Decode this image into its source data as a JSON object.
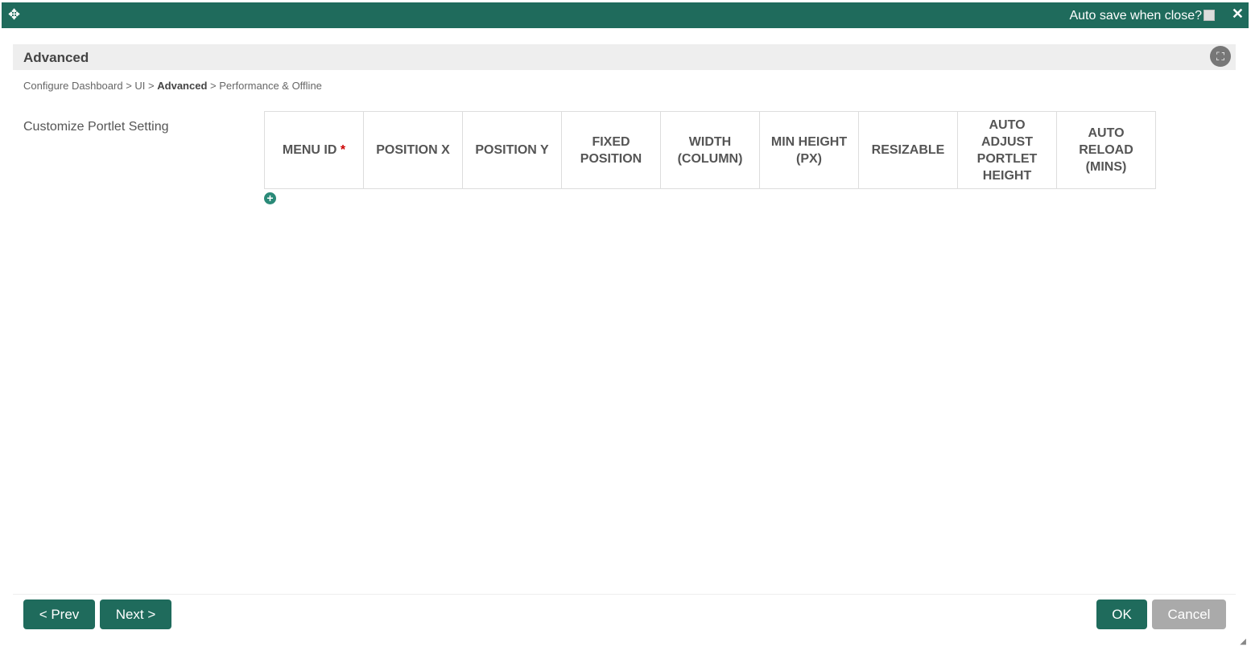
{
  "topbar": {
    "auto_save_label": "Auto save when close?",
    "auto_save_checked": false,
    "close": "✕"
  },
  "panel": {
    "title": "Advanced"
  },
  "breadcrumb": {
    "items": [
      "Configure Dashboard",
      "UI",
      "Advanced",
      "Performance & Offline"
    ],
    "sep": ">"
  },
  "section": {
    "label": "Customize Portlet Setting"
  },
  "table": {
    "headers": [
      "MENU ID",
      "POSITION X",
      "POSITION Y",
      "FIXED POSITION",
      "WIDTH (COLUMN)",
      "MIN HEIGHT (PX)",
      "RESIZABLE",
      "AUTO ADJUST PORTLET HEIGHT",
      "AUTO RELOAD (MINS)"
    ],
    "required_mark": "*"
  },
  "footer": {
    "prev": "< Prev",
    "next": "Next >",
    "ok": "OK",
    "cancel": "Cancel"
  },
  "colors": {
    "brand": "#1f6b5c",
    "disabled": "#aaaaaa"
  }
}
